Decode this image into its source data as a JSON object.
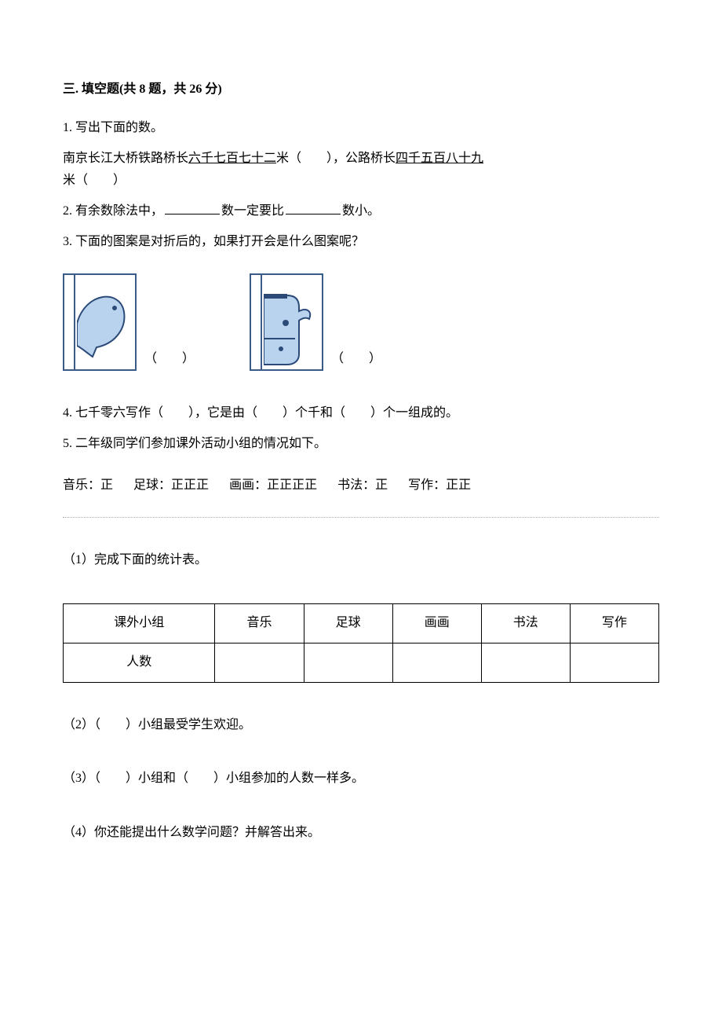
{
  "section": {
    "title": "三. 填空题(共 8 题，共 26 分)"
  },
  "q1": {
    "stem": "1. 写出下面的数。",
    "line_a": "南京长江大桥铁路桥长",
    "num_a": "六千七百七十二",
    "line_b": "米（　　），公路桥长",
    "num_b": "四千五百八十九",
    "line_c": "米（　　）"
  },
  "q2": {
    "text_a": "2. 有余数除法中，",
    "text_b": "数一定要比",
    "text_c": "数小。"
  },
  "q3": {
    "stem": "3. 下面的图案是对折后的，如果打开会是什么图案呢？",
    "blank": "（　　）"
  },
  "q4": {
    "text": "4. 七千零六写作（　　），它是由（　　）个千和（　　）个一组成的。"
  },
  "q5": {
    "stem": "5. 二年级同学们参加课外活动小组的情况如下。",
    "tally": {
      "music": {
        "label": "音乐：",
        "marks": "正"
      },
      "soccer": {
        "label": "足球：",
        "marks": "正正正"
      },
      "draw": {
        "label": "画画：",
        "marks": "正正正正"
      },
      "calli": {
        "label": "书法：",
        "marks": "正"
      },
      "write": {
        "label": "写作：",
        "marks": "正正"
      }
    },
    "sub1": "（1）完成下面的统计表。",
    "table": {
      "header": "课外小组",
      "row": "人数",
      "cols": [
        "音乐",
        "足球",
        "画画",
        "书法",
        "写作"
      ]
    },
    "sub2": "（2）（　　）小组最受学生欢迎。",
    "sub3": "（3）（　　）小组和（　　）小组参加的人数一样多。",
    "sub4": "（4）你还能提出什么数学问题？并解答出来。"
  }
}
